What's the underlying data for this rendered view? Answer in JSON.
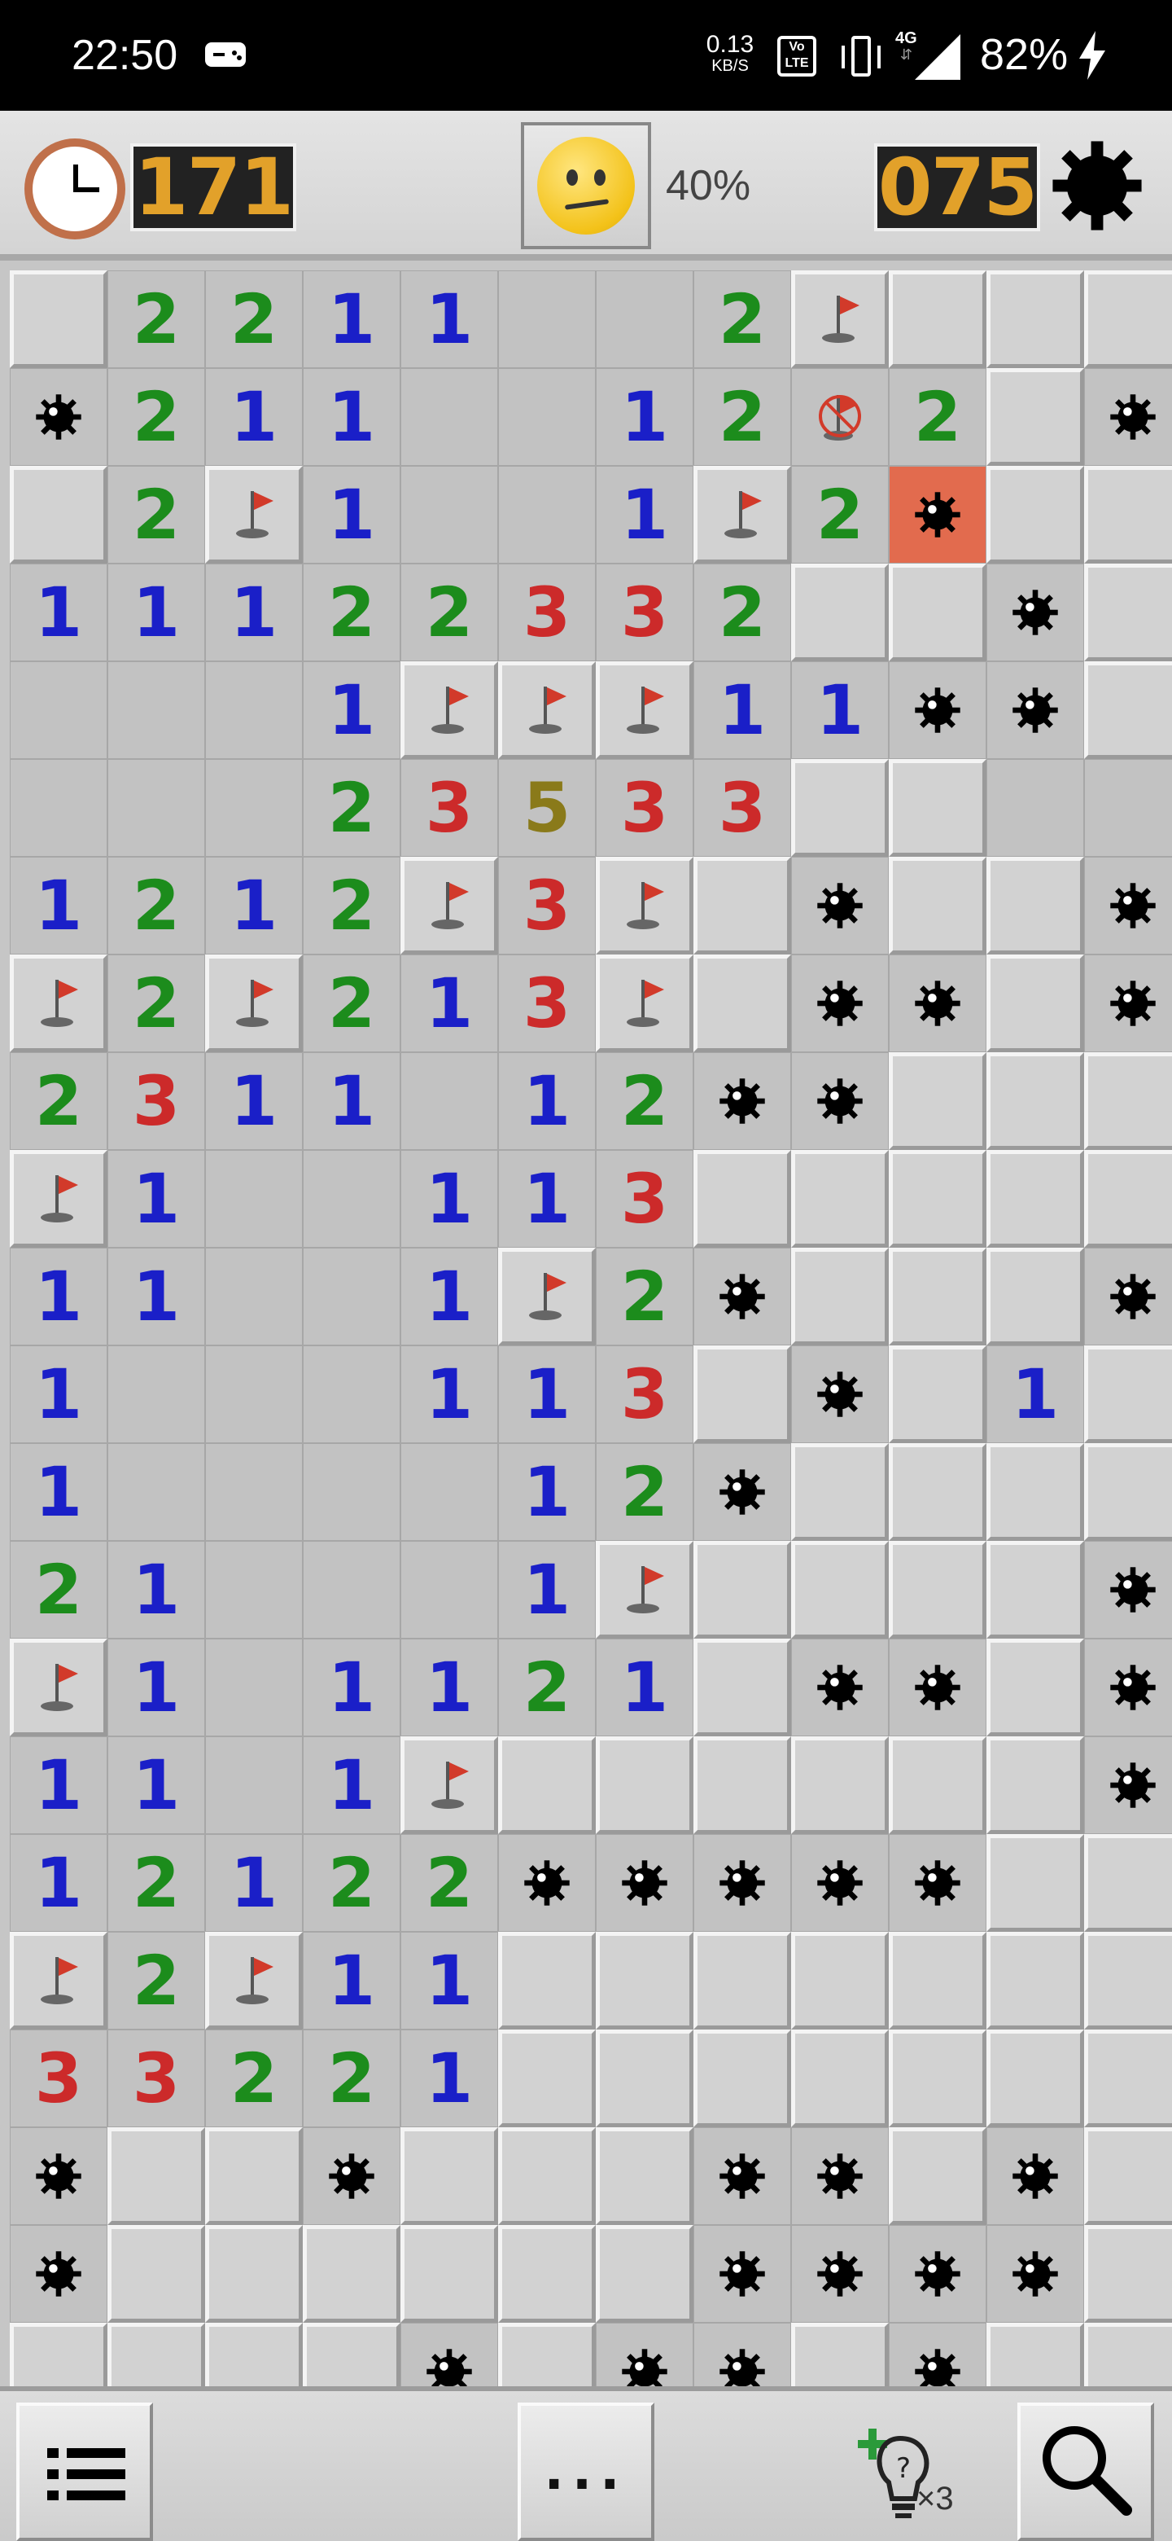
{
  "status_bar": {
    "time": "22:50",
    "net_speed_value": "0.13",
    "net_speed_unit": "KB/S",
    "volte": "Vo LTE",
    "network": "4G",
    "battery": "82%"
  },
  "toolbar": {
    "timer": "171",
    "mines_left": "075",
    "progress": "40%",
    "face": "worried"
  },
  "bottom_bar": {
    "more_label": "...",
    "hint_count": "×3"
  },
  "board": {
    "cols": 12,
    "rows": 22,
    "legend": "1-8 number, .=revealed empty, #=covered, F=flag, M=mine, X=wrong flag, B=exploded mine",
    "grid": [
      "#2211..2F###",
      "M211..12X2#M",
      "#2F1..1F2B##",
      "11122332##M#",
      "...1FFF11MM#",
      "...23533##..",
      "1212F3F#M##M",
      "F2F213F#MM#M",
      "2311.12MM###",
      "F1..113#####",
      "11..1F2M###M",
      "1...113#M#1#",
      "1....12M####",
      "21...1F####M",
      "F1.1121#MM#M",
      "11.1F######M",
      "12122MMMMM##",
      "F2F11#######",
      "33221#######",
      "M##M###MM#M#",
      "M######MMMM#",
      "####M#MM#M##"
    ]
  }
}
